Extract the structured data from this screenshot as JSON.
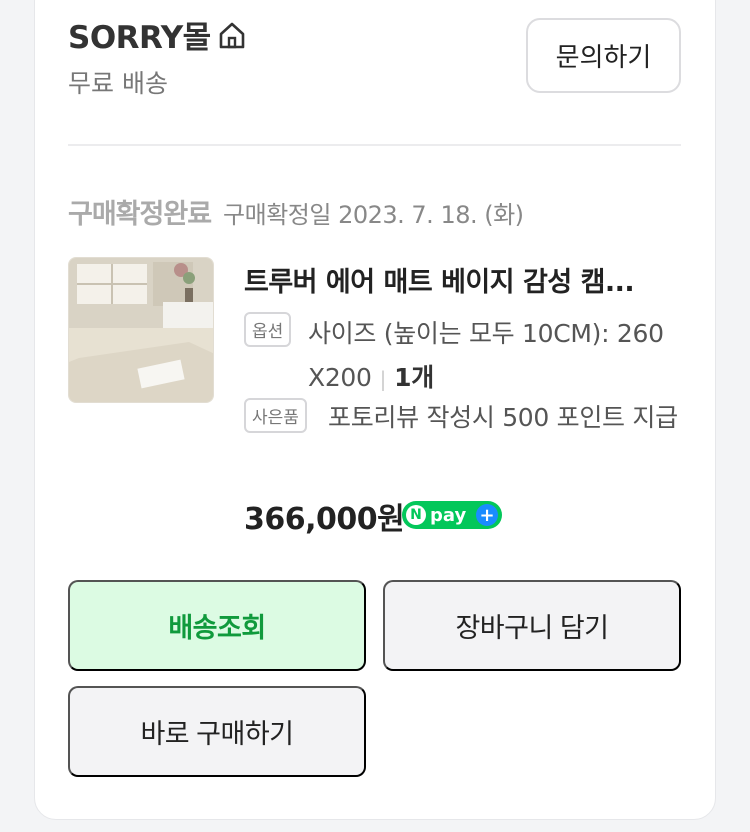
{
  "store": {
    "name": "SORRY몰",
    "shipping": "무료 배송",
    "inquiry_label": "문의하기"
  },
  "order": {
    "status": "구매확정완료",
    "status_date": "구매확정일 2023. 7. 18. (화)"
  },
  "product": {
    "title": "트루버 에어 매트 베이지 감성 캠...",
    "option_tag": "옵션",
    "option_text": "사이즈 (높이는 모두 10CM): 260 X200",
    "quantity": "1개",
    "gift_tag": "사은품",
    "gift_text": "포토리뷰 작성시 500 포인트 지급",
    "price": "366,000원"
  },
  "npay": {
    "n": "N",
    "pay": "pay",
    "plus": "+"
  },
  "buttons": {
    "track": "배송조회",
    "cart": "장바구니 담기",
    "buy": "바로 구매하기"
  },
  "colors": {
    "track_bg": "#dcfbe3",
    "track_text": "#109a3c",
    "npay_green": "#03c75a",
    "npay_plus_blue": "#1a8cff"
  },
  "icons": {
    "store_home": "home-icon"
  }
}
